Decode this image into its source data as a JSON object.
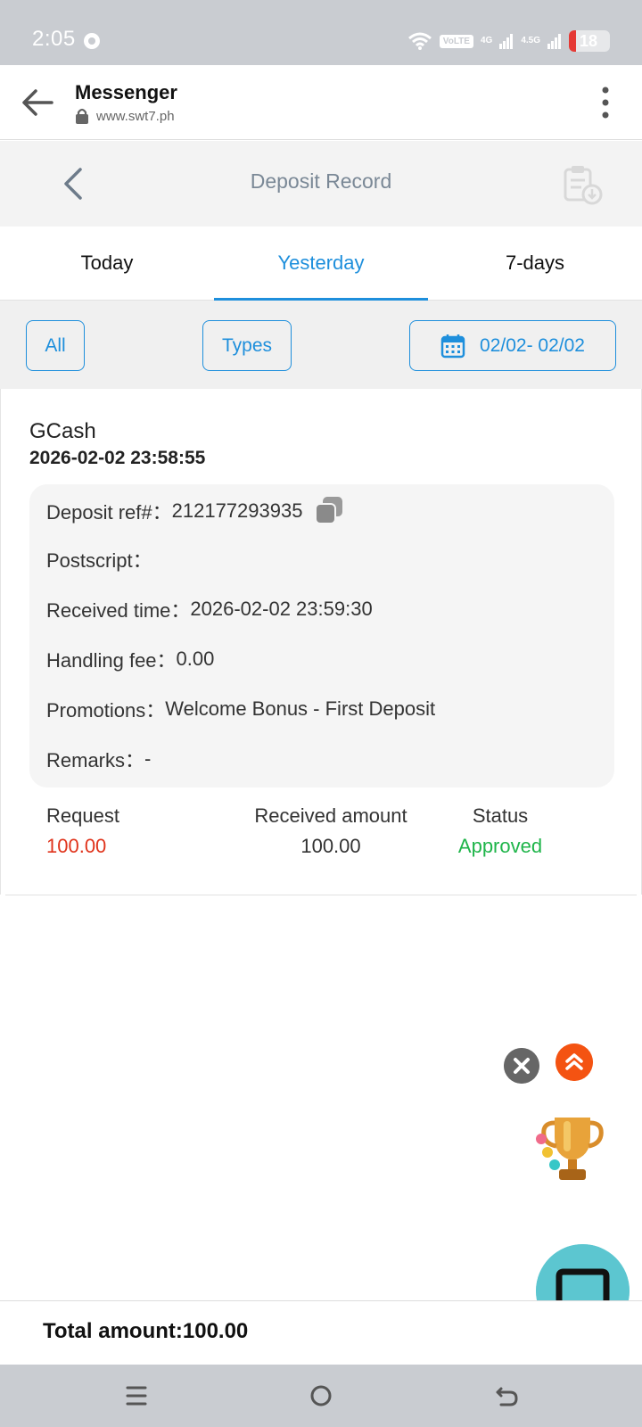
{
  "status_bar": {
    "time": "2:05",
    "volte": "VoLTE",
    "net1": "4G",
    "net2": "4.5G",
    "battery": "18"
  },
  "browser": {
    "title": "Messenger",
    "url": "www.swt7.ph"
  },
  "header": {
    "title": "Deposit Record"
  },
  "tabs": [
    {
      "label": "Today"
    },
    {
      "label": "Yesterday"
    },
    {
      "label": "7-days"
    }
  ],
  "filters": {
    "all": "All",
    "types": "Types",
    "date_range": "02/02- 02/02"
  },
  "record": {
    "method": "GCash",
    "time": "2026-02-02 23:58:55",
    "details": {
      "ref_label": "Deposit ref#：",
      "ref_value": "212177293935",
      "postscript_label": "Postscript：",
      "postscript_value": "",
      "received_time_label": "Received time：",
      "received_time_value": "2026-02-02 23:59:30",
      "handling_fee_label": "Handling fee：",
      "handling_fee_value": "0.00",
      "promotions_label": "Promotions：",
      "promotions_value": "Welcome Bonus - First Deposit",
      "remarks_label": "Remarks：",
      "remarks_value": "-"
    },
    "summary": {
      "request_label": "Request",
      "request_value": "100.00",
      "received_label": "Received amount",
      "received_value": "100.00",
      "status_label": "Status",
      "status_value": "Approved"
    }
  },
  "footer": {
    "total": "Total amount:100.00"
  },
  "colors": {
    "accent": "#1e8fdc",
    "request": "#e0341c",
    "approved": "#1fb54a",
    "chat": "#5cc6d0",
    "scroll_top": "#f45312"
  }
}
